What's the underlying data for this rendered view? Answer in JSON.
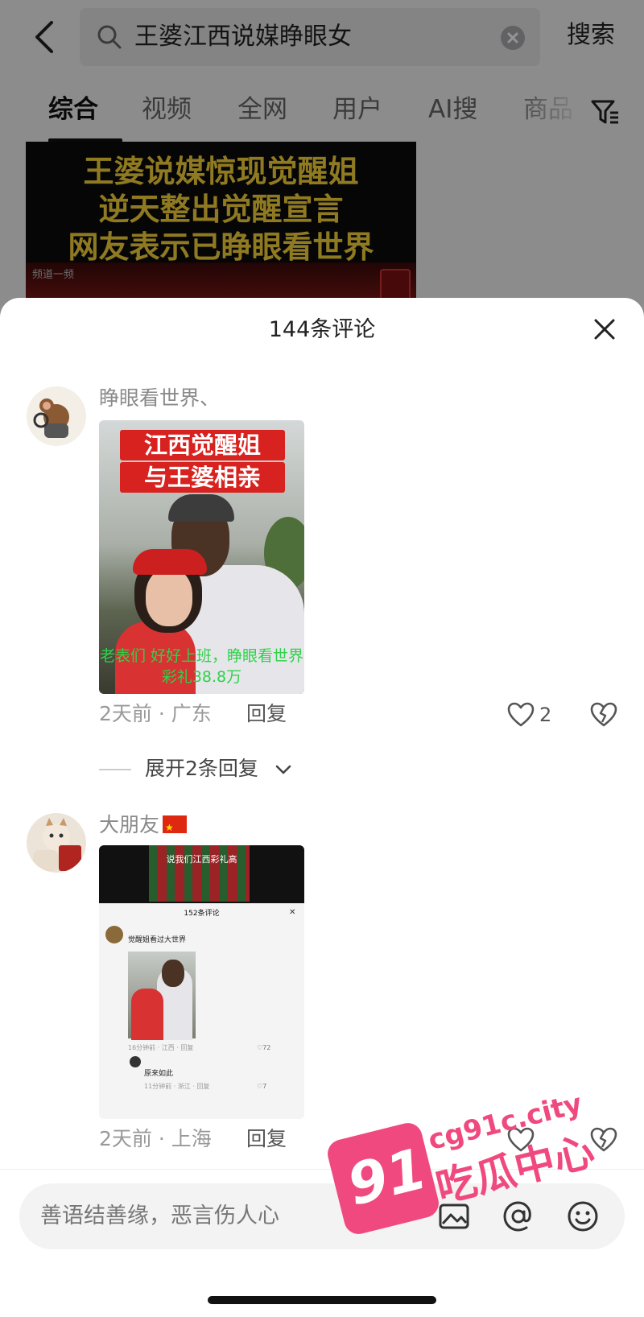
{
  "search": {
    "query": "王婆江西说媒睁眼女",
    "button_label": "搜索"
  },
  "tabs": [
    "综合",
    "视频",
    "全网",
    "用户",
    "AI搜",
    "商品"
  ],
  "video": {
    "title_lines": [
      "王婆说媒惊现觉醒姐",
      "逆天整出觉醒宣言",
      "网友表示已睁眼看世界"
    ],
    "source": "频道一频"
  },
  "sheet": {
    "title": "144条评论"
  },
  "comments": [
    {
      "username": "睁眼看世界、",
      "image": {
        "headline": [
          "江西觉醒姐",
          "与王婆相亲"
        ],
        "caption": "老表们 好好上班，睁眼看世界彩礼38.8万"
      },
      "time_location": "2天前 · 广东",
      "reply_label": "回复",
      "likes": "2",
      "expand_label": "展开2条回复"
    },
    {
      "username": "大朋友",
      "image": {
        "top_text": "说我们江西彩礼高",
        "inner_title": "152条评论",
        "inner_comment": "觉醒姐看过大世界",
        "inner_meta": "16分钟前 · 江西 · 回复",
        "inner_likes": "♡72",
        "inner_reply": "原来如此",
        "inner_meta2": "11分钟前 · 浙江 · 回复",
        "inner_likes2": "♡7"
      },
      "time_location": "2天前 · 上海",
      "reply_label": "回复"
    }
  ],
  "input": {
    "placeholder": "善语结善缘，恶言伤人心"
  },
  "watermark": {
    "number": "91",
    "domain": "cg91c.city",
    "text": "吃瓜中心"
  }
}
